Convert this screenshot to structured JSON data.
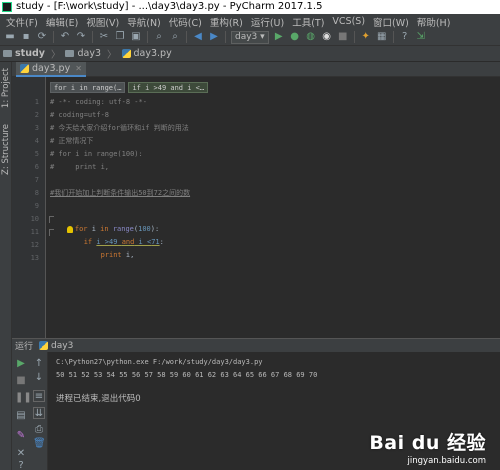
{
  "window": {
    "title": "study - [F:\\work\\study] - ...\\day3\\day3.py - PyCharm 2017.1.5"
  },
  "menu": [
    "文件(F)",
    "编辑(E)",
    "视图(V)",
    "导航(N)",
    "代码(C)",
    "重构(R)",
    "运行(U)",
    "工具(T)",
    "VCS(S)",
    "窗口(W)",
    "帮助(H)"
  ],
  "toolbar": {
    "run_config": "day3 ▾"
  },
  "nav": {
    "project": "study",
    "folder": "day3",
    "file": "day3.py"
  },
  "side_tabs": {
    "project": "1: Project",
    "structure": "Z: Structure"
  },
  "editor": {
    "tab_label": "day3.py",
    "breadcrumbs": [
      "for i in range(…",
      "if i >49 and i <…"
    ],
    "line_numbers": [
      "1",
      "2",
      "3",
      "4",
      "5",
      "6",
      "7",
      "8",
      "9",
      "10",
      "11",
      "12",
      "13"
    ],
    "lines": [
      "# -*- coding: utf-8 -*-",
      "# coding=utf-8",
      "# 今天给大家介绍for循环和if 判断的用法",
      "# 正常情况下",
      "# for i in range(100):",
      "#     print i,",
      "",
      "#我们开始加上判断条件输出50到72之间的数",
      "",
      "for i in range(100):",
      "    if i >49 and i <71:",
      "        print i,",
      ""
    ]
  },
  "run_panel": {
    "header_label": "运行",
    "config_name": "day3",
    "console_lines": [
      "C:\\Python27\\python.exe F:/work/study/day3/day3.py",
      "50 51 52 53 54 55 56 57 58 59 60 61 62 63 64 65 66 67 68 69 70",
      "",
      "进程已结束,退出代码0"
    ]
  },
  "watermark": {
    "logo": "Bai du 经验",
    "url": "jingyan.baidu.com"
  }
}
